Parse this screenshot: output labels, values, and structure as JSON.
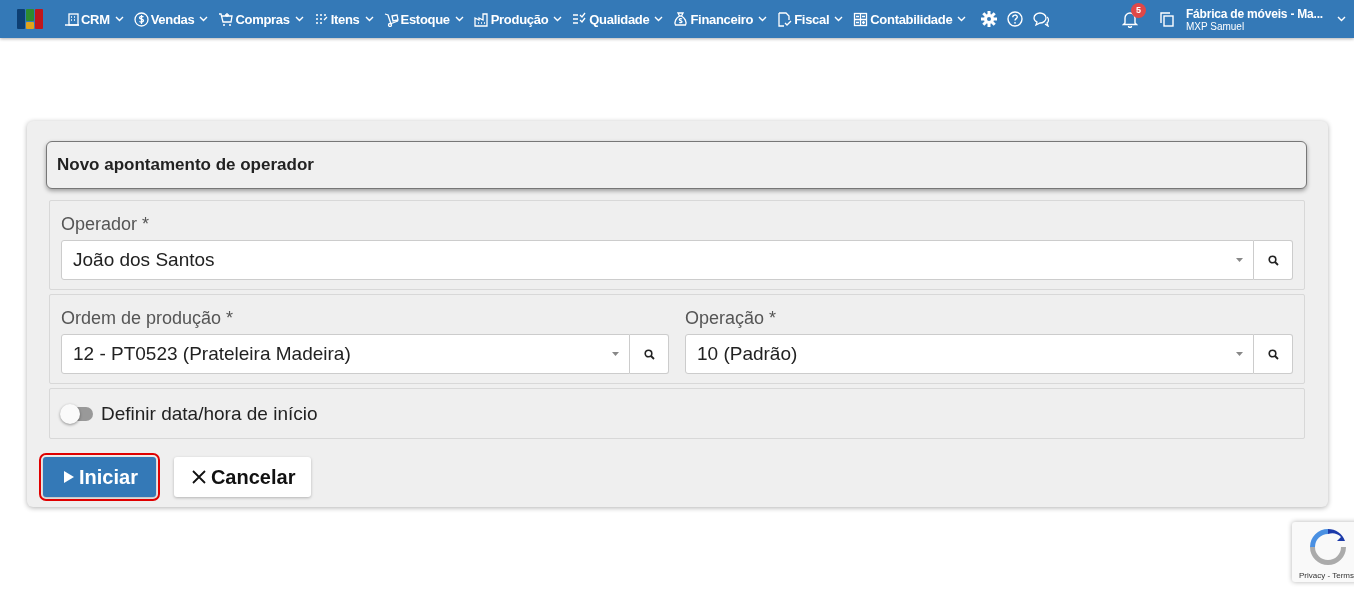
{
  "navbar": {
    "menus": [
      {
        "label": "CRM"
      },
      {
        "label": "Vendas"
      },
      {
        "label": "Compras"
      },
      {
        "label": "Itens"
      },
      {
        "label": "Estoque"
      },
      {
        "label": "Produção"
      },
      {
        "label": "Qualidade"
      },
      {
        "label": "Financeiro"
      },
      {
        "label": "Fiscal"
      },
      {
        "label": "Contabilidade"
      }
    ],
    "notifications": "5",
    "company": "Fábrica de móveis - Ma...",
    "user": "MXP Samuel"
  },
  "form": {
    "title": "Novo apontamento de operador",
    "rows": [
      {
        "fields": [
          {
            "label": "Operador *",
            "value": "João dos Santos"
          }
        ]
      },
      {
        "fields": [
          {
            "label": "Ordem de produção *",
            "value": "12 - PT0523 (Prateleira Madeira)"
          },
          {
            "label": "Operação *",
            "value": "10 (Padrão)"
          }
        ]
      }
    ],
    "toggle": {
      "label": "Definir data/hora de início",
      "on": false
    },
    "buttons": [
      {
        "kind": "primary",
        "label": "Iniciar",
        "highlighted": true
      },
      {
        "kind": "secondary",
        "label": "Cancelar",
        "highlighted": false
      }
    ]
  },
  "recaptcha": {
    "links": "Privacy - Terms"
  }
}
